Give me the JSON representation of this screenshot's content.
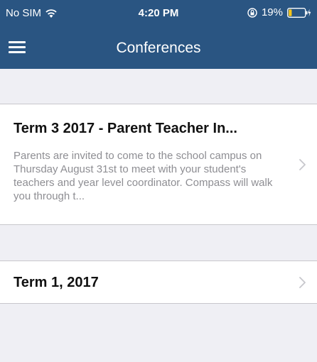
{
  "status_bar": {
    "carrier": "No SIM",
    "time": "4:20 PM",
    "battery_percent": "19%",
    "battery_level": 0.19
  },
  "nav": {
    "title": "Conferences",
    "menu_icon": "hamburger-icon"
  },
  "conferences": [
    {
      "title": "Term 3 2017 - Parent Teacher In...",
      "description": "Parents are invited to come to the school campus on Thursday August 31st to meet with your student's teachers and year level coordinator. Compass will walk you through t..."
    },
    {
      "title": "Term 1, 2017",
      "description": ""
    }
  ],
  "colors": {
    "header": "#2a5582",
    "background": "#efeff4",
    "card": "#ffffff",
    "title_text": "#111111",
    "description_text": "#8e8e93",
    "chevron": "#c7c7cc",
    "battery_fill": "#f5c518"
  }
}
